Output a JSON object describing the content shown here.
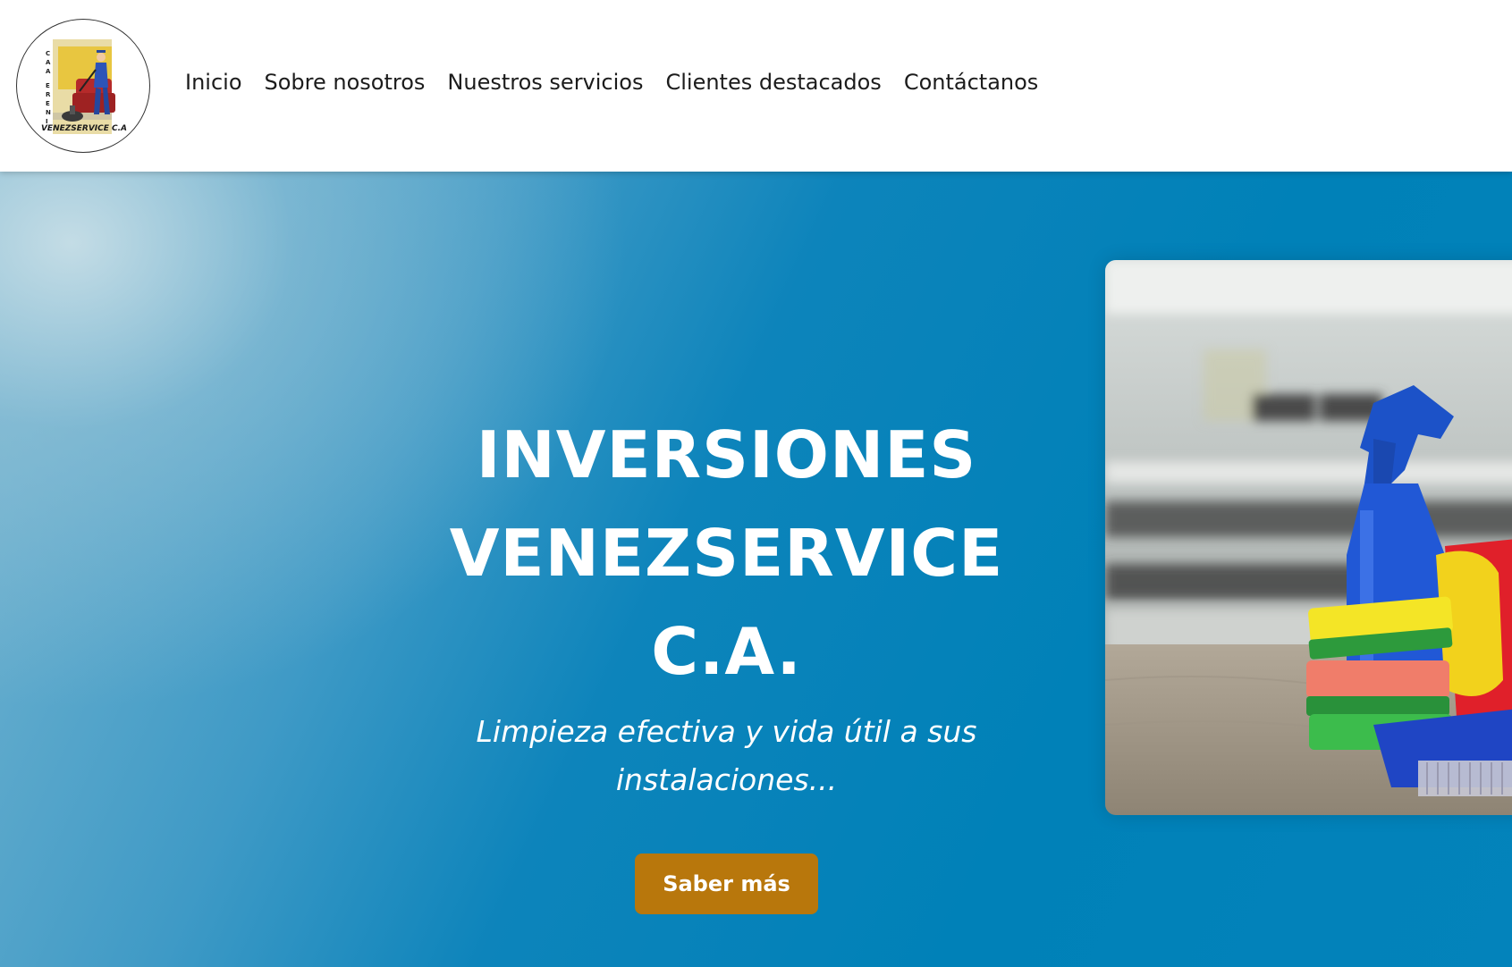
{
  "header": {
    "logo_caption": "VENEZSERVICE C.A",
    "logo_vertical_text": "INVERSIONES",
    "nav": [
      {
        "label": "Inicio"
      },
      {
        "label": "Sobre nosotros"
      },
      {
        "label": "Nuestros servicios"
      },
      {
        "label": "Clientes destacados"
      },
      {
        "label": "Contáctanos"
      }
    ]
  },
  "hero": {
    "title_line1": "INVERSIONES",
    "title_line2": "VENEZSERVICE",
    "title_line3": "C.A.",
    "subtitle_line1": "Limpieza efectiva y vida útil a sus",
    "subtitle_line2": "instalaciones...",
    "cta_label": "Saber más"
  },
  "colors": {
    "hero_blue": "#0081b8",
    "cta_gold": "#b8770c",
    "nav_text": "#1c1c1c"
  }
}
